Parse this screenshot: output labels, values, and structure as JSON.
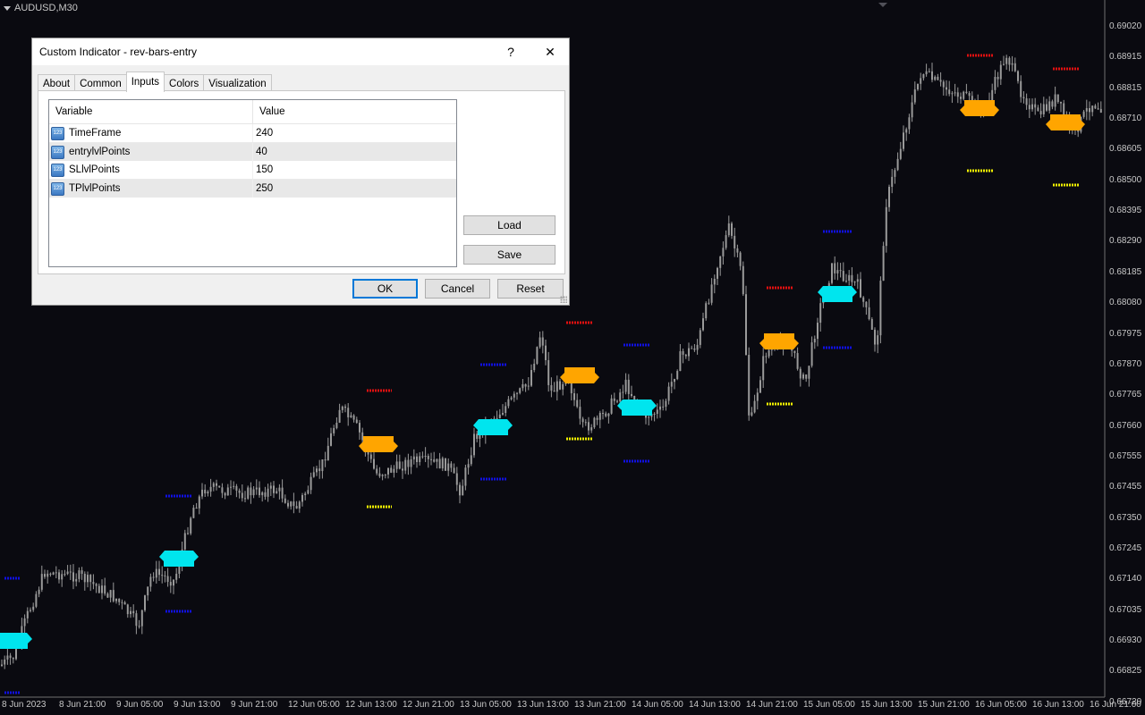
{
  "chart": {
    "symbol": "AUDUSD,M30",
    "price_labels": [
      "0.69020",
      "0.68915",
      "0.68815",
      "0.68710",
      "0.68605",
      "0.68500",
      "0.68395",
      "0.68290",
      "0.68185",
      "0.68080",
      "0.67975",
      "0.67870",
      "0.67765",
      "0.67660",
      "0.67555",
      "0.67455",
      "0.67350",
      "0.67245",
      "0.67140",
      "0.67035",
      "0.66930",
      "0.66825",
      "0.66720"
    ],
    "time_labels": [
      "8 Jun 2023",
      "8 Jun 21:00",
      "9 Jun 05:00",
      "9 Jun 13:00",
      "9 Jun 21:00",
      "12 Jun 05:00",
      "12 Jun 13:00",
      "12 Jun 21:00",
      "13 Jun 05:00",
      "13 Jun 13:00",
      "13 Jun 21:00",
      "14 Jun 05:00",
      "14 Jun 13:00",
      "14 Jun 21:00",
      "15 Jun 05:00",
      "15 Jun 13:00",
      "15 Jun 21:00",
      "16 Jun 05:00",
      "16 Jun 13:00",
      "16 Jun 21:00"
    ],
    "colors": {
      "background": "#0a0a10",
      "candles": "#9a9a9a",
      "buy_signal": "#00e5ee",
      "sell_signal": "#ffa500",
      "entry_level": "#1010e0",
      "sl_level": "#e01010",
      "tp_level": "#f0f000"
    }
  },
  "dialog": {
    "title": "Custom Indicator - rev-bars-entry",
    "help_label": "?",
    "close_label": "✕",
    "tabs": [
      {
        "label": "About"
      },
      {
        "label": "Common"
      },
      {
        "label": "Inputs"
      },
      {
        "label": "Colors"
      },
      {
        "label": "Visualization"
      }
    ],
    "active_tab": "Inputs",
    "grid": {
      "headers": [
        "Variable",
        "Value"
      ],
      "rows": [
        {
          "variable": "TimeFrame",
          "value": "240"
        },
        {
          "variable": "entrylvlPoints",
          "value": "40"
        },
        {
          "variable": "SLlvlPoints",
          "value": "150"
        },
        {
          "variable": "TPlvlPoints",
          "value": "250"
        }
      ],
      "row_icon": "numeric-parameter-icon",
      "row_icon_text": "123"
    },
    "buttons": {
      "load": "Load",
      "save": "Save",
      "ok": "OK",
      "cancel": "Cancel",
      "reset": "Reset"
    }
  }
}
